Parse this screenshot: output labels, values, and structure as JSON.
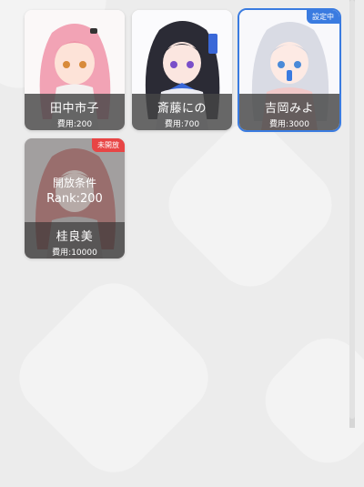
{
  "colors": {
    "selected_accent": "#3a7be0",
    "locked_badge": "#e84545",
    "name_band": "#464646"
  },
  "characters": [
    {
      "name": "田中市子",
      "cost": "費用:200",
      "hair": "pink",
      "state": "unlocked"
    },
    {
      "name": "斎藤にの",
      "cost": "費用:700",
      "hair": "black",
      "state": "unlocked"
    },
    {
      "name": "吉岡みよ",
      "cost": "費用:3000",
      "hair": "silver",
      "state": "selected",
      "badge": "設定中"
    },
    {
      "name": "桂良美",
      "cost": "費用:10000",
      "hair": "red",
      "state": "locked",
      "badge": "未開放",
      "unlock_condition": "開放条件",
      "unlock_rank": "Rank:200"
    }
  ]
}
